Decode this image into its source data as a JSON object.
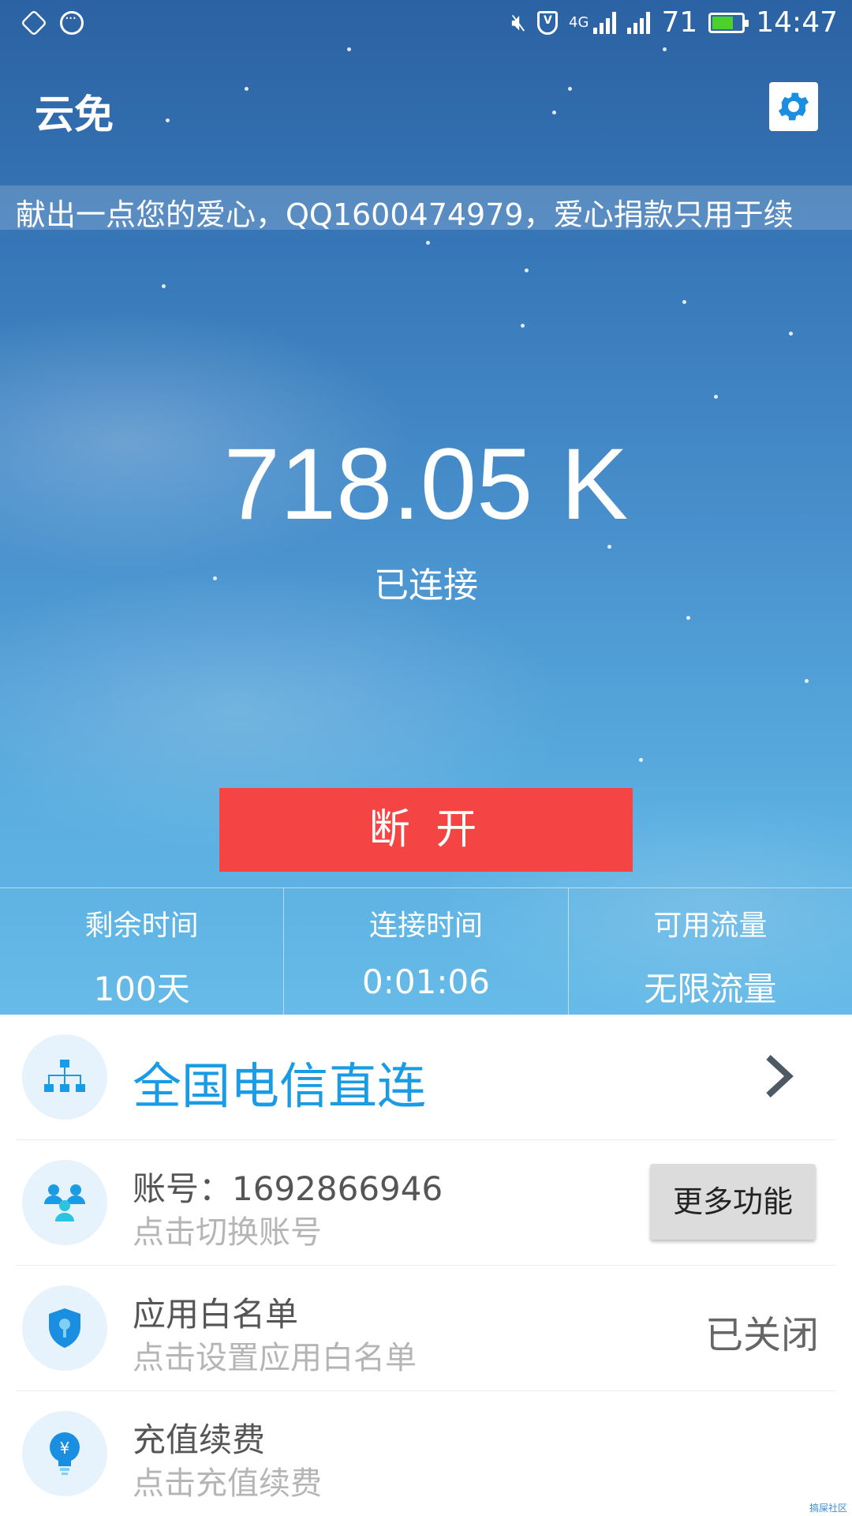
{
  "status_bar": {
    "network_type": "4G",
    "battery": "71",
    "time": "14:47",
    "icons": [
      "heart-shield-icon",
      "chat-dots-icon",
      "mute-icon",
      "vpn-shield-icon",
      "signal-icon",
      "battery-icon"
    ],
    "battery_color": "#4cd02b"
  },
  "app_bar": {
    "title": "云免",
    "settings_icon": "gear-icon"
  },
  "marquee": {
    "text": "献出一点您的爱心，QQ1600474979，爱心捐款只用于续"
  },
  "speed": {
    "value": "718.05 K",
    "status": "已连接"
  },
  "disconnect_button": {
    "label": "断 开",
    "color": "#f44444"
  },
  "stats": [
    {
      "label": "剩余时间",
      "value": "100天"
    },
    {
      "label": "连接时间",
      "value": "0:01:06"
    },
    {
      "label": "可用流量",
      "value": "无限流量"
    }
  ],
  "list": {
    "route": {
      "label": "全国电信直连",
      "icon": "network-tree-icon"
    },
    "account": {
      "title": "账号：1692866946",
      "subtitle": "点击切换账号",
      "button": "更多功能",
      "icon": "users-icon"
    },
    "whitelist": {
      "title": "应用白名单",
      "subtitle": "点击设置应用白名单",
      "state": "已关闭",
      "icon": "shield-key-icon"
    },
    "recharge": {
      "title": "充值续费",
      "subtitle": "点击充值续费",
      "icon": "yen-bulb-icon"
    }
  },
  "watermark": "搞屎社区",
  "accent_color": "#1a9be6"
}
